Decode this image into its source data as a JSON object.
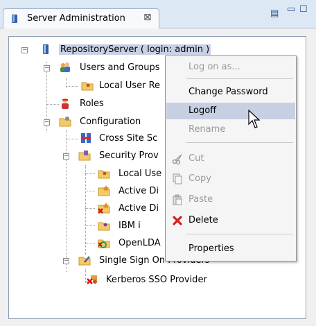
{
  "view": {
    "tab_title": "Server Administration",
    "close_glyph": "⊠",
    "minimize_glyph": "▭",
    "maximize_glyph": "☐",
    "menu_glyph": "▤"
  },
  "tree": {
    "server": "RepositoryServer ( login: admin )",
    "users_and_groups": "Users and Groups",
    "local_user_registry": "Local User Re",
    "roles": "Roles",
    "configuration": "Configuration",
    "cross_site": "Cross Site Sc",
    "security_providers": "Security Prov",
    "local_user": "Local Use",
    "active_directory_1": "Active Di",
    "active_directory_2": "Active Di",
    "ibm_i": "IBM i",
    "openldap": "OpenLDA",
    "single_sign_on": "Single Sign On Providers",
    "kerberos": "Kerberos SSO Provider"
  },
  "context_menu": {
    "log_on_as": "Log on as...",
    "change_password": "Change Password",
    "logoff": "Logoff",
    "rename": "Rename",
    "cut": "Cut",
    "copy": "Copy",
    "paste": "Paste",
    "delete": "Delete",
    "properties": "Properties"
  },
  "colors": {
    "selection": "#c8d0e4",
    "menu_highlight": "#c7cfe3",
    "disabled_text": "#9a9a9a"
  }
}
